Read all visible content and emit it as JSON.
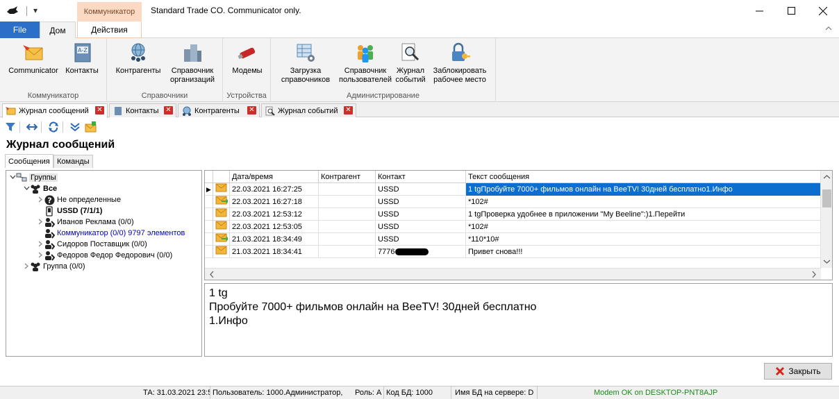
{
  "titlebar": {
    "context_tab": "Коммуникатор",
    "title": "Standard Trade CO. Communicator only.",
    "qa_symbol": "▾"
  },
  "ribbon_tabs": {
    "file": "File",
    "home": "Дом",
    "actions": "Действия"
  },
  "ribbon": {
    "groups": [
      {
        "label": "Коммуникатор",
        "buttons": [
          "Communicator",
          "Контакты"
        ]
      },
      {
        "label": "Справочники",
        "buttons": [
          "Контрагенты",
          "Справочник организаций"
        ]
      },
      {
        "label": "Устройства",
        "buttons": [
          "Модемы"
        ]
      },
      {
        "label": "Администрирование",
        "buttons": [
          "Загрузка справочников",
          "Справочник пользователей",
          "Журнал событий",
          "Заблокировать рабочее место"
        ]
      }
    ],
    "btn_lines": {
      "communicator": [
        "Communicator"
      ],
      "contacts": [
        "Контакты"
      ],
      "counterparties": [
        "Контрагенты"
      ],
      "orgs": [
        "Справочник",
        "организаций"
      ],
      "modems": [
        "Модемы"
      ],
      "load": [
        "Загрузка",
        "справочников"
      ],
      "users": [
        "Справочник",
        "пользователей"
      ],
      "events": [
        "Журнал",
        "событий"
      ],
      "lock": [
        "Заблокировать",
        "рабочее место"
      ]
    }
  },
  "doc_tabs": [
    "Журнал сообщений",
    "Контакты",
    "Контрагенты",
    "Журнал событий"
  ],
  "page_title": "Журнал сообщений",
  "inner_tabs": [
    "Сообщения",
    "Команды"
  ],
  "tree": {
    "root": "Группы",
    "all": "Все",
    "items": [
      "Не определенные",
      "USSD (7/1/1)",
      "Иванов Реклама (0/0)",
      "Коммуникатор (0/0) 9797 элементов",
      "Сидоров Поставщик (0/0)",
      "Федоров Федор Федорович (0/0)"
    ],
    "group": "Группа (0/0)"
  },
  "grid": {
    "columns": [
      "Дата/время",
      "Контрагент",
      "Контакт",
      "Текст сообщения"
    ],
    "rows": [
      {
        "dir": "in",
        "datetime": "22.03.2021 16:27:25",
        "counterparty": "",
        "contact": "USSD",
        "text": "1 tgПробуйте 7000+ фильмов онлайн на BeeTV! 30дней бесплатно1.Инфо"
      },
      {
        "dir": "out",
        "datetime": "22.03.2021 16:27:18",
        "counterparty": "",
        "contact": "USSD",
        "text": "*102#"
      },
      {
        "dir": "in",
        "datetime": "22.03.2021 12:53:12",
        "counterparty": "",
        "contact": "USSD",
        "text": "1 tgПроверка удобнее в приложении \"My Beeline\":)1.Перейти"
      },
      {
        "dir": "in",
        "datetime": "22.03.2021 12:53:05",
        "counterparty": "",
        "contact": "USSD",
        "text": "*102#"
      },
      {
        "dir": "out",
        "datetime": "21.03.2021 18:34:49",
        "counterparty": "",
        "contact": "USSD",
        "text": "*110*10#"
      },
      {
        "dir": "in",
        "datetime": "21.03.2021 18:34:41",
        "counterparty": "",
        "contact": "7776",
        "text": "Привет снова!!!"
      }
    ]
  },
  "preview": [
    "1 tg",
    "Пробуйте 7000+ фильмов онлайн на BeeTV! 30дней бесплатно",
    "1.Инфо"
  ],
  "close_label": "Закрыть",
  "status": {
    "ta": "ТА: 31.03.2021 23:5",
    "user": "Пользователь: 1000.Администратор,",
    "role": "Роль: А",
    "db_code": "Код БД: 1000",
    "db_name": "Имя БД на сервере: D",
    "modem": "Modem OK on DESKTOP-PNT8AJP"
  },
  "colors": {
    "file_tab": "#2b6fc9",
    "context_tab": "#fbd9c3",
    "selection": "#0c6fcf",
    "modem_ok": "#1a8a1a",
    "link": "#0000cc"
  }
}
